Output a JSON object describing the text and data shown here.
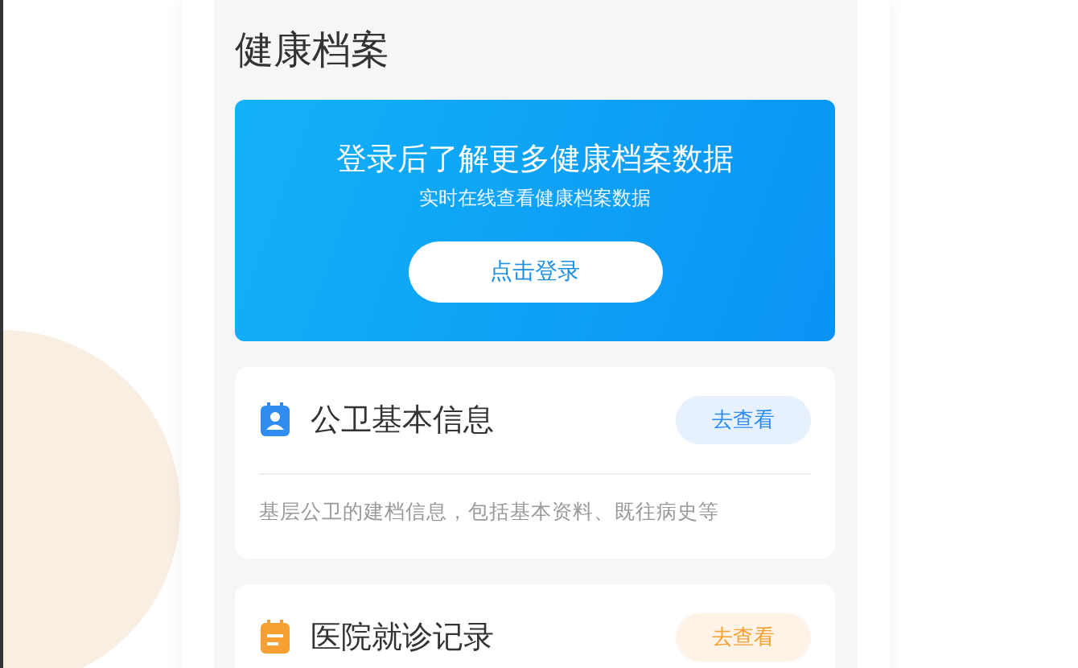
{
  "page": {
    "title": "健康档案"
  },
  "login_banner": {
    "headline": "登录后了解更多健康档案数据",
    "subtitle": "实时在线查看健康档案数据",
    "button": "点击登录"
  },
  "cards": [
    {
      "kind": "profile",
      "title": "公卫基本信息",
      "button": "去查看",
      "color": "#2f8cf0",
      "description": "基层公卫的建档信息，包括基本资料、既往病史等"
    },
    {
      "kind": "calendar",
      "title": "医院就诊记录",
      "button": "去查看",
      "color": "#f5a031"
    }
  ]
}
